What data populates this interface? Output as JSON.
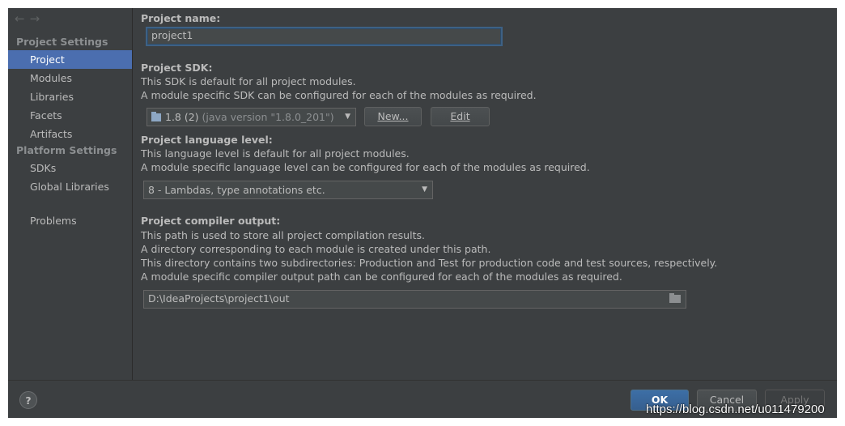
{
  "sidebar": {
    "nav_back": "←",
    "nav_forward": "→",
    "project_settings_header": "Project Settings",
    "project_settings_items": [
      "Project",
      "Modules",
      "Libraries",
      "Facets",
      "Artifacts"
    ],
    "platform_settings_header": "Platform Settings",
    "platform_settings_items": [
      "SDKs",
      "Global Libraries"
    ],
    "other_items": [
      "Problems"
    ],
    "selected": "Project"
  },
  "content": {
    "project_name_label": "Project name:",
    "project_name_value": "project1",
    "sdk_label": "Project SDK:",
    "sdk_desc_1": "This SDK is default for all project modules.",
    "sdk_desc_2": "A module specific SDK can be configured for each of the modules as required.",
    "sdk_selected": "1.8 (2)",
    "sdk_selected_detail": "(java version \"1.8.0_201\")",
    "sdk_new_button": "New...",
    "sdk_edit_button": "Edit",
    "language_label": "Project language level:",
    "language_desc_1": "This language level is default for all project modules.",
    "language_desc_2": "A module specific language level can be configured for each of the modules as required.",
    "language_selected": "8 - Lambdas, type annotations etc.",
    "compiler_label": "Project compiler output:",
    "compiler_desc_1": "This path is used to store all project compilation results.",
    "compiler_desc_2": "A directory corresponding to each module is created under this path.",
    "compiler_desc_3": "This directory contains two subdirectories: Production and Test for production code and test sources, respectively.",
    "compiler_desc_4": "A module specific compiler output path can be configured for each of the modules as required.",
    "compiler_output_path": "D:\\IdeaProjects\\project1\\out"
  },
  "footer": {
    "help_label": "?",
    "ok_label": "OK",
    "cancel_label": "Cancel",
    "apply_label": "Apply"
  },
  "watermark": "https://blog.csdn.net/u011479200",
  "colors": {
    "background": "#3c3f41",
    "selection": "#4b6eaf",
    "primary_button": "#365f8f"
  }
}
